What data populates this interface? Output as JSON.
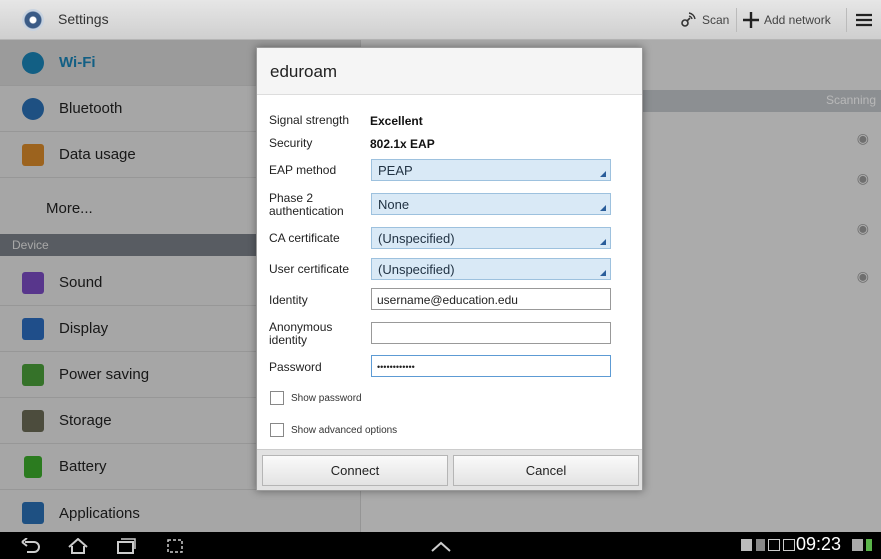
{
  "topbar": {
    "app_icon": "settings-icon",
    "title": "Settings",
    "scan_label": "Scan",
    "add_network_label": "Add network",
    "menu_icon": "menu-icon"
  },
  "sidebar": {
    "items": [
      {
        "label": "Wi-Fi",
        "icon": "wifi-icon",
        "color": "#1a84b8",
        "active": true
      },
      {
        "label": "Bluetooth",
        "icon": "bluetooth-icon",
        "color": "#2a6fb4"
      },
      {
        "label": "Data usage",
        "icon": "data-usage-icon",
        "color": "#d98a2a"
      },
      {
        "label": "More...",
        "icon": "",
        "color": ""
      }
    ],
    "section_device": "Device",
    "device_items": [
      {
        "label": "Sound",
        "icon": "sound-icon",
        "color": "#7a4cc2"
      },
      {
        "label": "Display",
        "icon": "display-icon",
        "color": "#2b6cc0"
      },
      {
        "label": "Power saving",
        "icon": "power-saving-icon",
        "color": "#4a9e3a"
      },
      {
        "label": "Storage",
        "icon": "storage-icon",
        "color": "#6a6a55"
      },
      {
        "label": "Battery",
        "icon": "battery-icon",
        "color": "#3cab2c"
      },
      {
        "label": "Applications",
        "icon": "applications-icon",
        "color": "#2a6fb4"
      }
    ]
  },
  "networks": {
    "scanning_label": "Scanning"
  },
  "dialog": {
    "title": "eduroam",
    "signal_label": "Signal strength",
    "signal_value": "Excellent",
    "security_label": "Security",
    "security_value": "802.1x EAP",
    "eap_label": "EAP method",
    "eap_value": "PEAP",
    "phase2_label_1": "Phase 2",
    "phase2_label_2": "authentication",
    "phase2_value": "None",
    "ca_label": "CA certificate",
    "ca_value": "(Unspecified)",
    "user_cert_label": "User certificate",
    "user_cert_value": "(Unspecified)",
    "identity_label": "Identity",
    "identity_value": "username@education.edu",
    "anon_label_1": "Anonymous",
    "anon_label_2": "identity",
    "anon_value": "",
    "password_label": "Password",
    "password_value": "••••••••••••",
    "show_password_label": "Show password",
    "show_advanced_label": "Show advanced options",
    "connect_label": "Connect",
    "cancel_label": "Cancel"
  },
  "statusbar": {
    "time": "09:23"
  }
}
